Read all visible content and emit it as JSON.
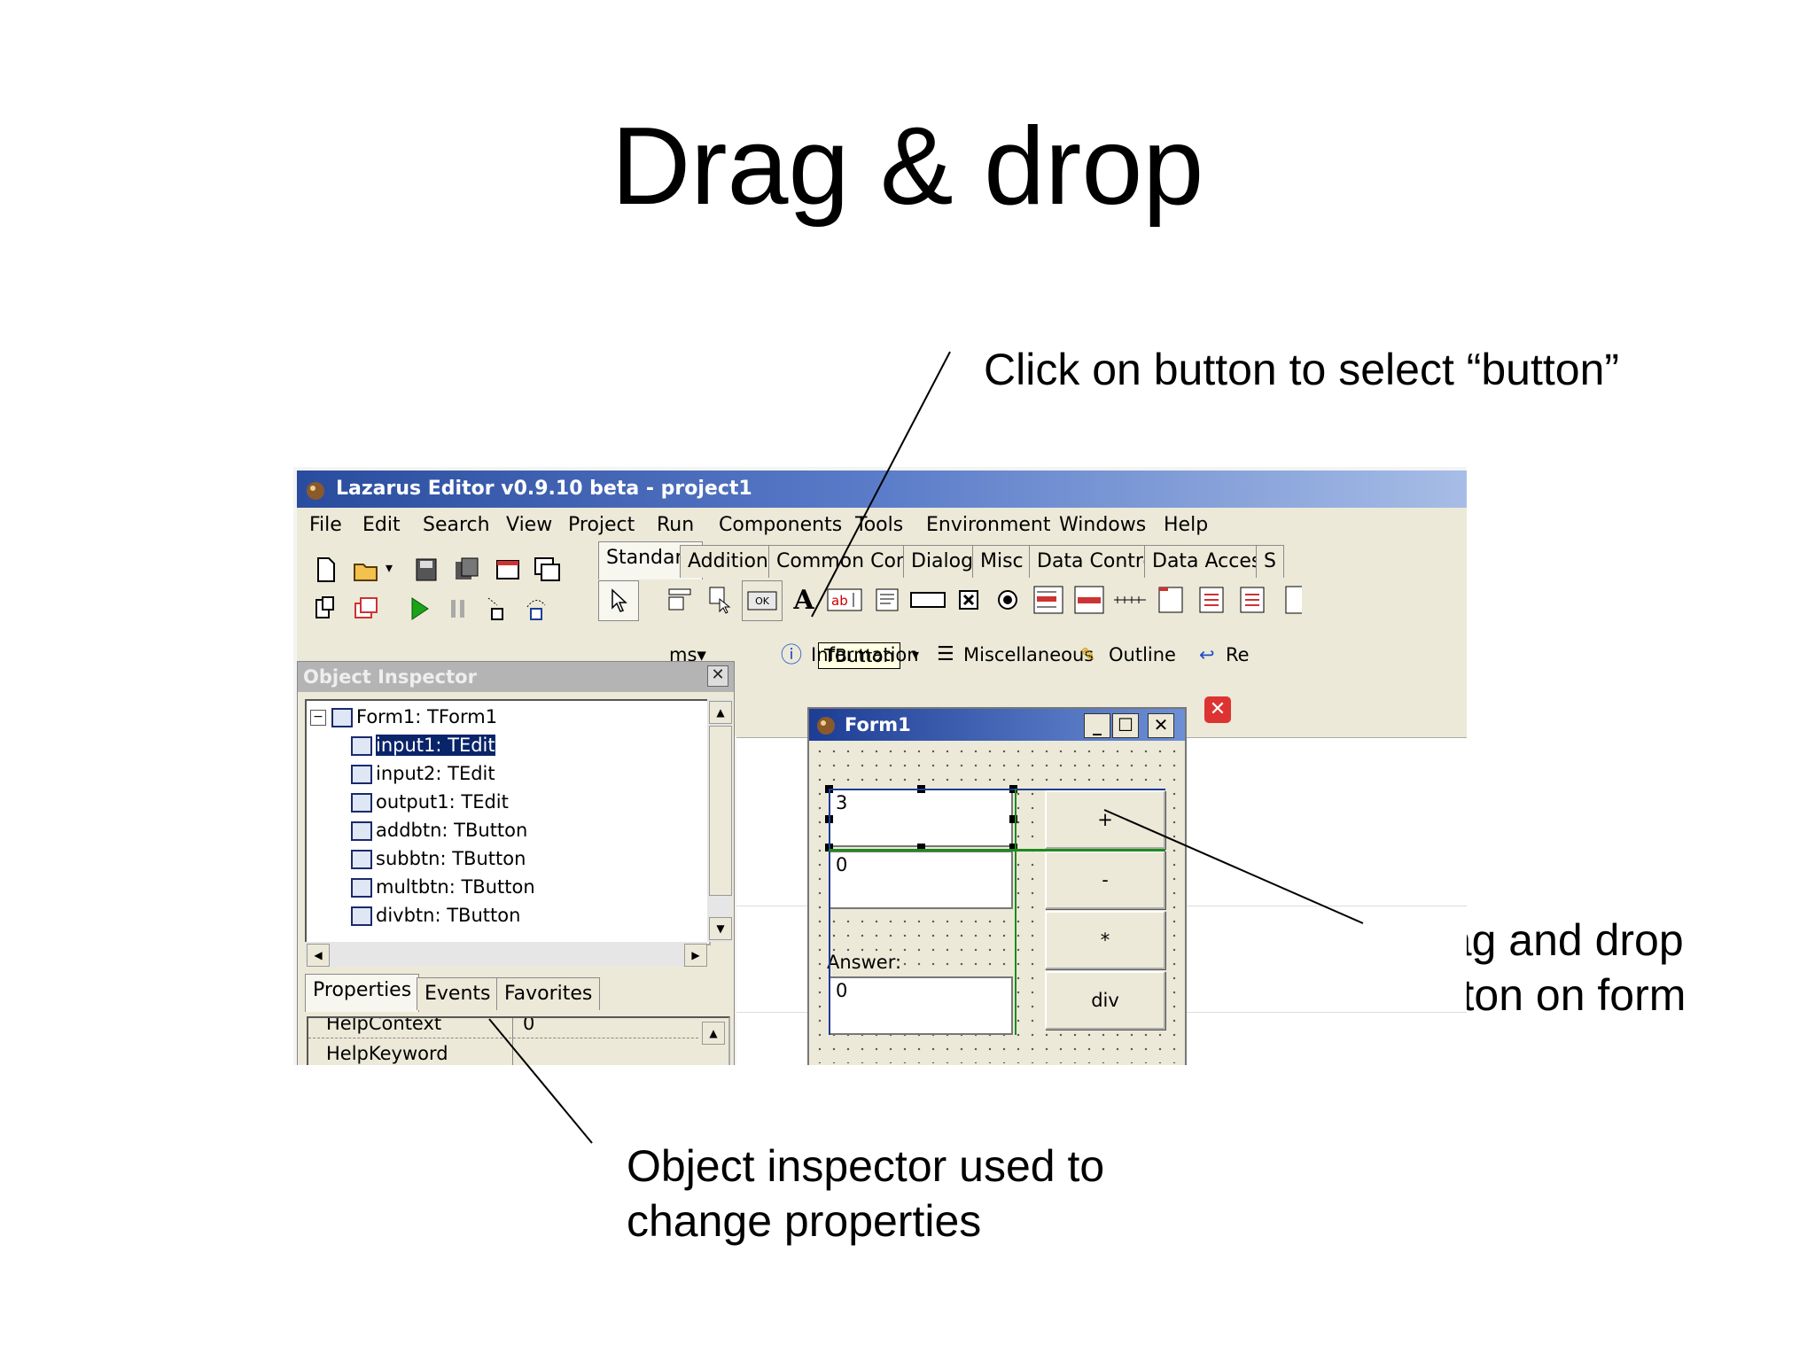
{
  "slide": {
    "title": "Drag & drop",
    "caption_click": "Click on button to select “button”",
    "caption_drag": "Drag and drop button on form",
    "caption_inspector": "Object inspector used to change properties"
  },
  "ide": {
    "title": "Lazarus Editor v0.9.10 beta - project1",
    "menu": [
      "File",
      "Edit",
      "Search",
      "View",
      "Project",
      "Run",
      "Components",
      "Tools",
      "Environment",
      "Windows",
      "Help"
    ],
    "palette_tabs": [
      "Standard",
      "Additional",
      "Common Controls",
      "Dialogs",
      "Misc",
      "Data Controls",
      "Data Access",
      "S"
    ],
    "tooltip": "TButton",
    "toolbar2": [
      "Information",
      "Miscellaneous",
      "Outline",
      "Re"
    ]
  },
  "object_inspector": {
    "title": "Object Inspector",
    "tree": [
      "Form1: TForm1",
      "input1: TEdit",
      "input2: TEdit",
      "output1: TEdit",
      "addbtn: TButton",
      "subbtn: TButton",
      "multbtn: TButton",
      "divbtn: TButton"
    ],
    "tabs": [
      "Properties",
      "Events",
      "Favorites"
    ],
    "props": [
      {
        "name": "HelpContext",
        "value": "0"
      },
      {
        "name": "HelpKeyword",
        "value": ""
      }
    ]
  },
  "form1": {
    "title": "Form1",
    "input1": "3",
    "input2": "0",
    "answer_label": "Answer:",
    "output": "0",
    "buttons": [
      "+",
      "-",
      "*",
      "div"
    ]
  }
}
